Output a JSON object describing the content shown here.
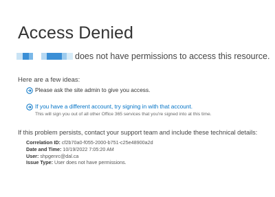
{
  "page": {
    "title": "Access Denied",
    "subtitle_suffix": "does not have permissions to access this resource."
  },
  "ideas": {
    "heading": "Here are a few ideas:",
    "items": [
      {
        "text": "Please ask the site admin to give you access."
      },
      {
        "link": "If you have a different account, try signing in with that account.",
        "note": "This will sign you out of all other Office 365 services that you're signed into at this time."
      }
    ]
  },
  "support": {
    "heading": "If this problem persists, contact your support team and include these technical details:",
    "details": [
      {
        "label": "Correlation ID:",
        "value": "cf2b70a0-f055-2000-b751-c25e48900a2d"
      },
      {
        "label": "Date and Time:",
        "value": "10/19/2022 7:05:20 AM"
      },
      {
        "label": "User:",
        "value": "shpgenrc@dal.ca"
      },
      {
        "label": "Issue Type:",
        "value": "User does not have permissions."
      }
    ]
  },
  "colors": {
    "link": "#0072c6",
    "redaction": [
      "#c9e3f5",
      "#3b8fd6",
      "#7ab8e8",
      "#b6d8f2",
      "#3b8fd6",
      "#9ccbee",
      "#d6ebf8"
    ]
  },
  "icons": {
    "idea_bullet": "circle-arrow-right-icon"
  }
}
